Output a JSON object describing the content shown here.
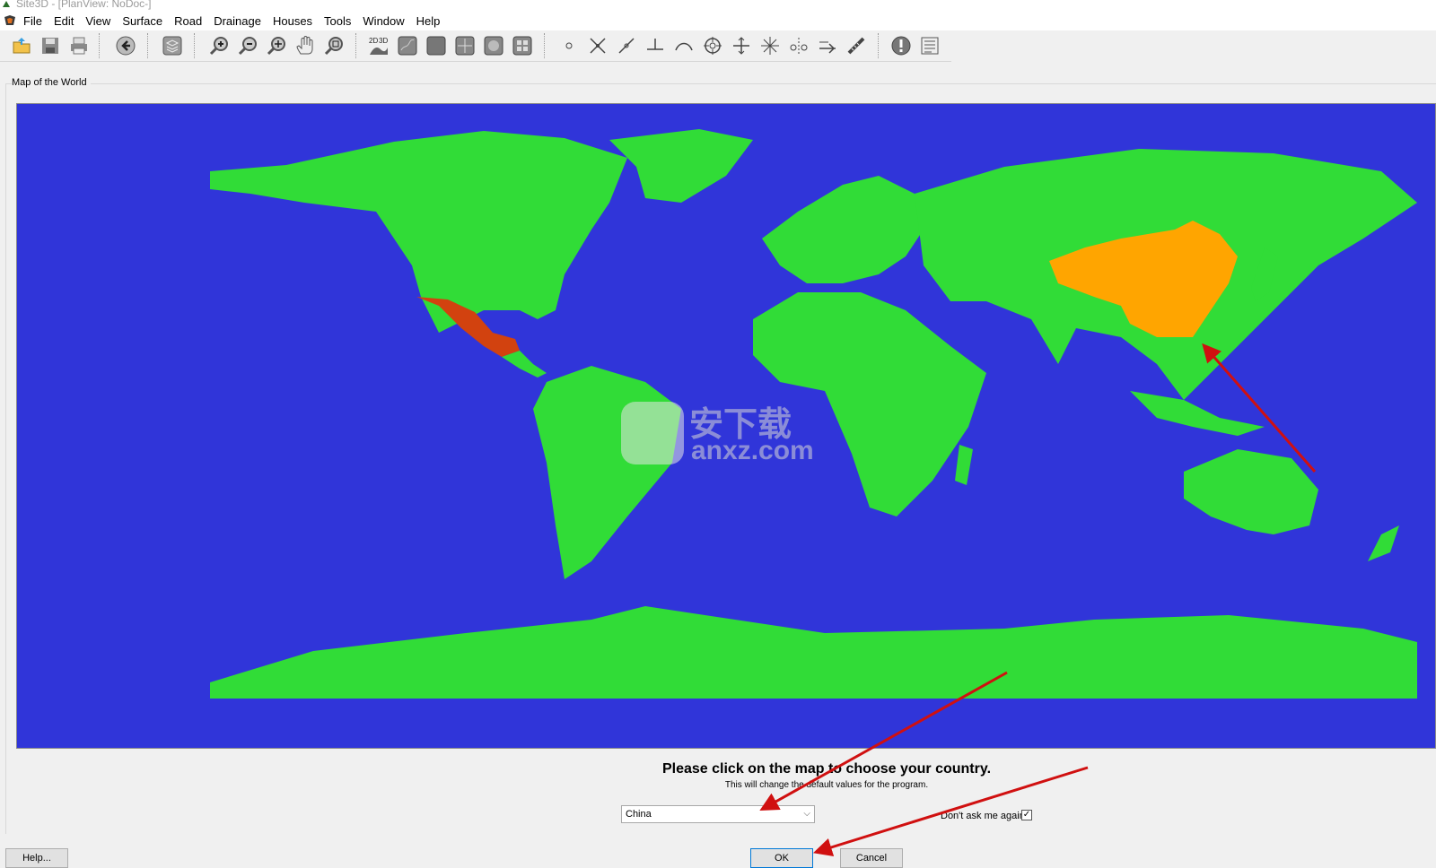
{
  "window": {
    "title": "Site3D - [PlanView: NoDoc-]"
  },
  "menu": {
    "items": [
      "File",
      "Edit",
      "View",
      "Surface",
      "Road",
      "Drainage",
      "Houses",
      "Tools",
      "Window",
      "Help"
    ]
  },
  "toolbar": {
    "buttons": [
      "open-icon",
      "save-icon",
      "print-icon",
      "back-icon",
      "layers-icon",
      "zoom-in-icon",
      "zoom-out-icon",
      "zoom-window-icon",
      "pan-hand-icon",
      "zoom-extents-icon",
      "2d-3d-icon",
      "surface-shade-icon",
      "surface-flat-icon",
      "sections-icon",
      "globe-icon",
      "grid-view-icon",
      "point-icon",
      "cross-icon",
      "line-icon",
      "perpendicular-icon",
      "arc-icon",
      "target-icon",
      "move-icon",
      "snap-icon",
      "dimension-icon",
      "offset-icon",
      "measure-icon",
      "info-icon",
      "report-icon"
    ]
  },
  "panel": {
    "label": "Map of the World"
  },
  "map": {
    "ocean_color": "#3035d9",
    "land_color": "#31dc37",
    "highlighted_countries": [
      {
        "name": "China",
        "color": "#ffa500"
      },
      {
        "name": "Mexico",
        "color": "#d2420f"
      }
    ]
  },
  "prompt": {
    "main": "Please click on the map to choose your country.",
    "sub": "This will change the default values for the program."
  },
  "country_select": {
    "value": "China"
  },
  "dont_ask": {
    "label": "Don't ask me again",
    "checked": true,
    "mark": "✓"
  },
  "buttons": {
    "help": "Help...",
    "ok": "OK",
    "cancel": "Cancel"
  },
  "watermark": {
    "text": "安下载",
    "sub": "anxz.com"
  },
  "annotation_color": "#d01010"
}
